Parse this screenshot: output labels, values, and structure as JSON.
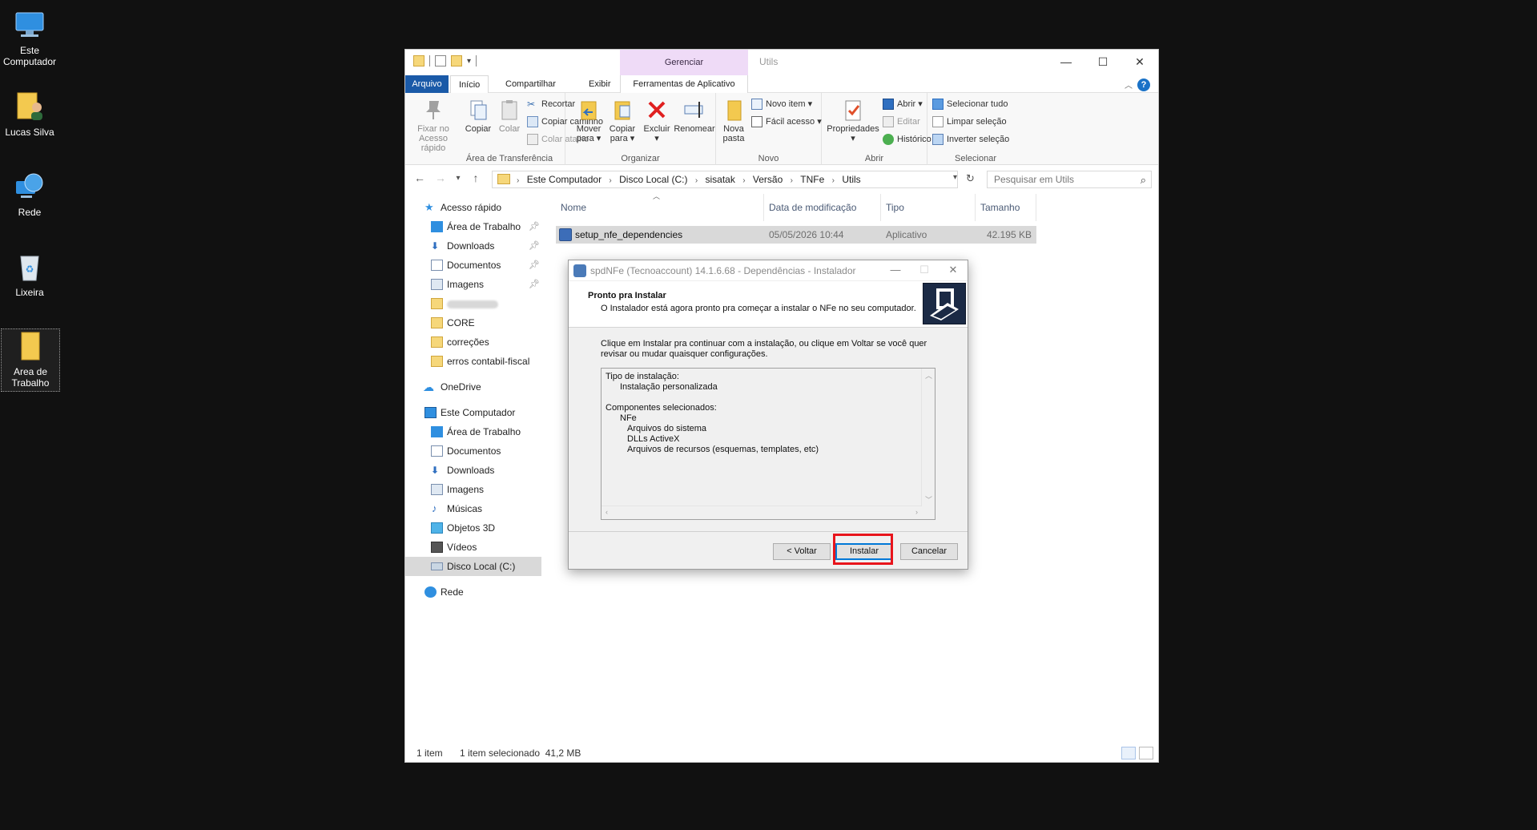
{
  "desktop": {
    "icons": [
      {
        "label": "Este Computador"
      },
      {
        "label": "Lucas Silva"
      },
      {
        "label": "Rede"
      },
      {
        "label": "Lixeira"
      },
      {
        "label": "Area de Trabalho"
      }
    ]
  },
  "explorer": {
    "contextual_tab_group": "Gerenciar",
    "title": "Utils",
    "tabs": {
      "arquivo": "Arquivo",
      "inicio": "Início",
      "compartilhar": "Compartilhar",
      "exibir": "Exibir",
      "ferramentas": "Ferramentas de Aplicativo"
    },
    "ribbon": {
      "area_transferencia": {
        "label": "Área de Transferência",
        "fixar": "Fixar no Acesso rápido",
        "copiar": "Copiar",
        "colar": "Colar",
        "recortar": "Recortar",
        "copiar_caminho": "Copiar caminho",
        "colar_atalho": "Colar atalho"
      },
      "organizar": {
        "label": "Organizar",
        "mover": "Mover para",
        "copiar_para": "Copiar para",
        "excluir": "Excluir",
        "renomear": "Renomear"
      },
      "novo": {
        "label": "Novo",
        "nova_pasta": "Nova pasta",
        "novo_item": "Novo item",
        "facil_acesso": "Fácil acesso"
      },
      "abrir": {
        "label": "Abrir",
        "propriedades": "Propriedades",
        "abrir": "Abrir",
        "editar": "Editar",
        "historico": "Histórico"
      },
      "selecionar": {
        "label": "Selecionar",
        "selecionar_tudo": "Selecionar tudo",
        "limpar_selecao": "Limpar seleção",
        "inverter_selecao": "Inverter seleção"
      }
    },
    "address": {
      "crumbs": [
        "Este Computador",
        "Disco Local (C:)",
        "sisatak",
        "Versão",
        "TNFe",
        "Utils"
      ],
      "search_placeholder": "Pesquisar em Utils"
    },
    "nav": {
      "acesso_rapido": "Acesso rápido",
      "quick": [
        "Área de Trabalho",
        "Downloads",
        "Documentos",
        "Imagens"
      ],
      "folders": [
        "CORE",
        "correções",
        "erros contabil-fiscal"
      ],
      "onedrive": "OneDrive",
      "este_computador": "Este Computador",
      "pc_items": [
        "Área de Trabalho",
        "Documentos",
        "Downloads",
        "Imagens",
        "Músicas",
        "Objetos 3D",
        "Vídeos",
        "Disco Local (C:)"
      ],
      "rede": "Rede"
    },
    "columns": {
      "nome": "Nome",
      "data": "Data de modificação",
      "tipo": "Tipo",
      "tamanho": "Tamanho"
    },
    "files": [
      {
        "name": "setup_nfe_dependencies",
        "date": "05/05/2026 10:44",
        "type": "Aplicativo",
        "size": "42.195 KB"
      }
    ],
    "status": {
      "count": "1 item",
      "selected": "1 item selecionado  41,2 MB"
    }
  },
  "dialog": {
    "title": "spdNFe (Tecnoaccount) 14.1.6.68 - Dependências - Instalador",
    "heading": "Pronto pra Instalar",
    "subheading": "O Instalador está agora pronto pra começar a instalar o NFe no seu computador.",
    "body_line1": "Clique em Instalar pra continuar com a instalação, ou clique em Voltar se você quer",
    "body_line2": "revisar ou mudar quaisquer configurações.",
    "memo": {
      "l1": "Tipo de instalação:",
      "l2": "Instalação personalizada",
      "l3": "Componentes selecionados:",
      "l4": "NFe",
      "l5": "Arquivos do sistema",
      "l6": "DLLs ActiveX",
      "l7": "Arquivos de recursos (esquemas, templates, etc)"
    },
    "buttons": {
      "back": "< Voltar",
      "install": "Instalar",
      "cancel": "Cancelar"
    }
  }
}
